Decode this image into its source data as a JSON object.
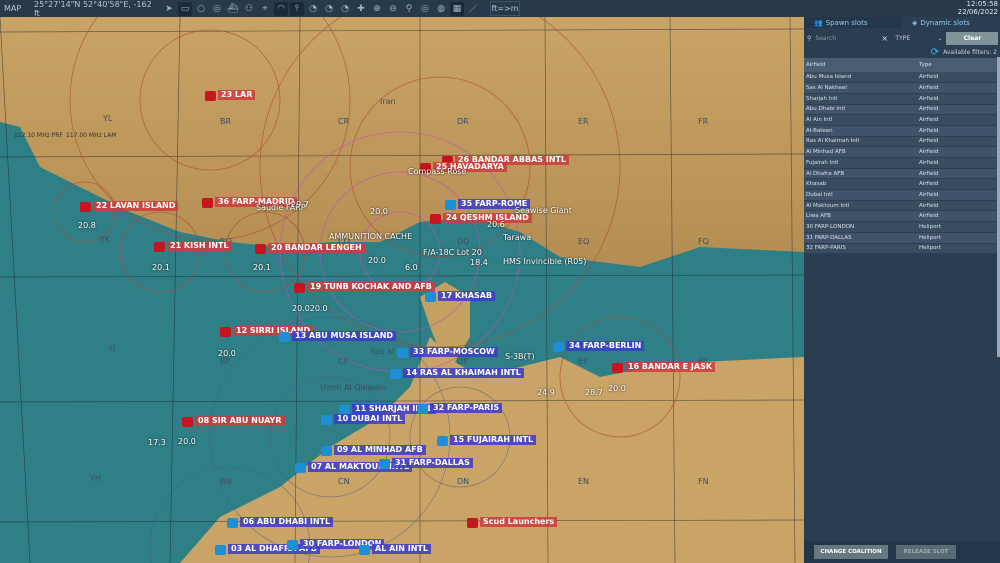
{
  "topbar": {
    "title": "MAP",
    "coordinates": "25°27'14\"N 52°40'58\"E, -162 ft",
    "units": "ft=>m",
    "time": "12:05:58",
    "date": "22/06/2022",
    "icons": [
      "navigate-icon",
      "label-toggle-icon",
      "circle-icon",
      "view-icon",
      "ship-icon",
      "network-icon",
      "target-icon",
      "wifi-icon",
      "tower-icon",
      "radar-icon",
      "radar2-icon",
      "radar3-icon",
      "move-icon",
      "zoom-in-icon",
      "zoom-out-icon",
      "zoom-fit-icon",
      "compass-icon",
      "globe-icon",
      "grid-icon",
      "ruler-icon"
    ]
  },
  "panel": {
    "tabs": [
      "Spawn slots",
      "Dynamic slots"
    ],
    "search_placeholder": "Search",
    "type_filter": "TYPE",
    "clear_label": "Clear",
    "available_filters": "Available filters: 2",
    "columns": [
      "Airfield",
      "Type"
    ],
    "rows": [
      [
        "Abu Musa Island",
        "Airfield"
      ],
      [
        "Sas Al Nakheel",
        "Airfield"
      ],
      [
        "Sharjah Intl",
        "Airfield"
      ],
      [
        "Abu Dhabi Intl",
        "Airfield"
      ],
      [
        "Al Ain Intl",
        "Airfield"
      ],
      [
        "Al-Bateen",
        "Airfield"
      ],
      [
        "Ras Al Khaimah Intl",
        "Airfield"
      ],
      [
        "Al Minhad AFB",
        "Airfield"
      ],
      [
        "Fujairah Intl",
        "Airfield"
      ],
      [
        "Al Dhafra AFB",
        "Airfield"
      ],
      [
        "Khasab",
        "Airfield"
      ],
      [
        "Dubai Intl",
        "Airfield"
      ],
      [
        "Al Maktoum Intl",
        "Airfield"
      ],
      [
        "Liwa AFB",
        "Airfield"
      ],
      [
        "30 FARP-LONDON",
        "Heliport"
      ],
      [
        "31 FARP-DALLAS",
        "Heliport"
      ],
      [
        "32 FARP-PARIS",
        "Heliport"
      ]
    ],
    "change_coalition": "CHANGE COALITION",
    "release_slot": "RELEASE SLOT"
  },
  "map": {
    "labels": [
      "26 BANDAR ABBAS INTL",
      "25 HAVADARYA",
      "23 LAR",
      "22 LAVAN ISLAND",
      "36 FARP-MADRID",
      "21 KISH INTL",
      "20 BANDAR LENGEH",
      "24 QESHM ISLAND",
      "35 FARP-ROME",
      "19 TUNB KOCHAK AND AFB",
      "17 KHASAB",
      "12 SIRRI ISLAND",
      "13 ABU MUSA ISLAND",
      "33 FARP-MOSCOW",
      "34 FARP-BERLIN",
      "16 BANDAR E JASK",
      "14 RAS AL KHAIMAH INTL",
      "08 SIR ABU NUAYR",
      "11 SHARJAH INTL",
      "32 FARP-PARIS",
      "10 DUBAI INTL",
      "15 FUJAIRAH INTL",
      "09 AL MINHAD AFB",
      "07 AL MAKTOUM INTL",
      "31 FARP-DALLAS",
      "06 ABU DHABI INTL",
      "03 AL DHAFRA AFB",
      "30 FARP-LONDON",
      "AL AIN INTL",
      "Scud Launchers",
      "AMMUNITION CACHE",
      "Seawise Giant",
      "Tarawa",
      "HMS Invincible (R05)",
      "F/A-18C Lot 20",
      "Compass Rose",
      "S-3B(T)",
      "Saudie FARP"
    ],
    "numbers": [
      "20.8",
      "20.1",
      "20.1",
      "20.0",
      "6.0",
      "18.4",
      "20.6",
      "20.0",
      "20.020.0",
      "17.3",
      "20.0",
      "24.9",
      "28.7",
      "20.0",
      "29.7",
      "20.0"
    ],
    "grid": [
      "YL",
      "BR",
      "CR",
      "DR",
      "ER",
      "FR",
      "YK",
      "BQ",
      "CQ",
      "DQ",
      "EQ",
      "FQ",
      "YJ",
      "BP",
      "CP",
      "DP",
      "EP",
      "FP",
      "YH",
      "BN",
      "CN",
      "DN",
      "EN",
      "FN",
      "Iran",
      "Umm Al Qaiwain",
      "Ras al"
    ],
    "navaids": [
      "112.10 MHz PRF",
      "117.00 MHz LAM"
    ],
    "colors": {
      "red": "#c8141e",
      "blue": "#1d8fd6",
      "land": "#c9a466",
      "sea": "#2f7f86"
    }
  }
}
